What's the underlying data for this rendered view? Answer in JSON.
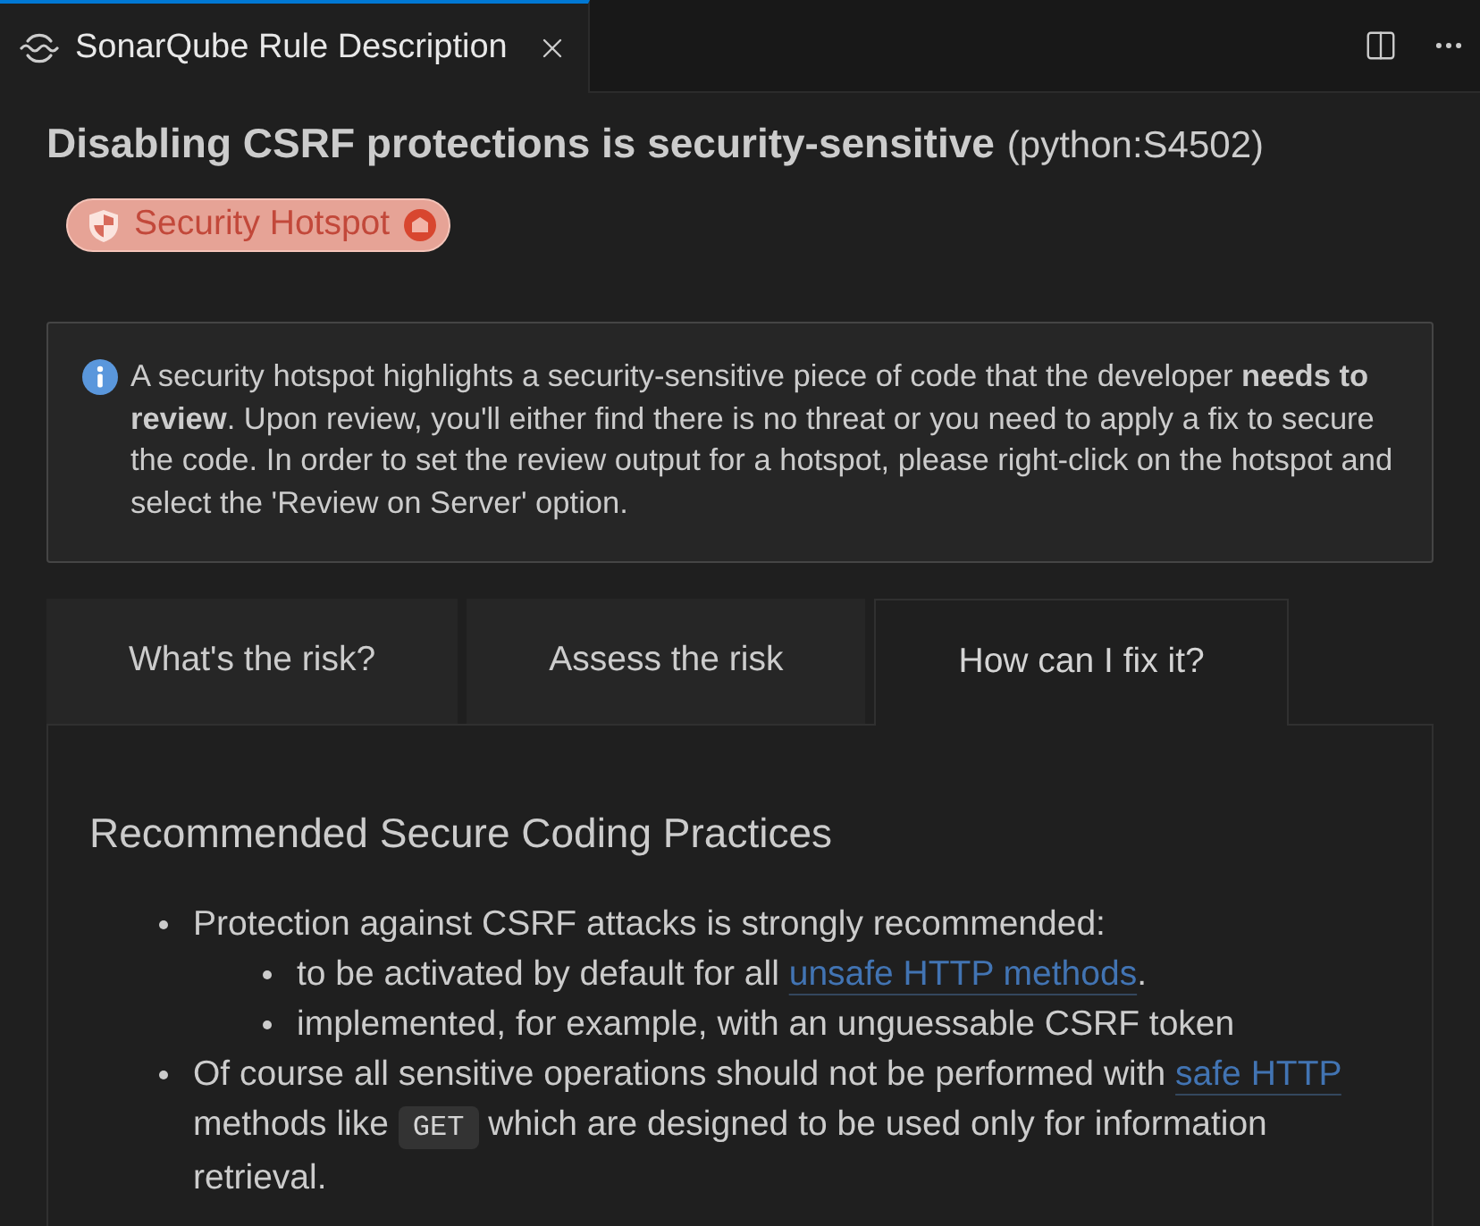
{
  "editor_tab": {
    "title": "SonarQube Rule Description",
    "selected": true
  },
  "rule": {
    "title": "Disabling CSRF protections is security-sensitive",
    "key": "(python:S4502)",
    "badge": {
      "label": "Security Hotspot"
    }
  },
  "notice": {
    "text": "A security hotspot highlights a security-sensitive piece of code that the developer **needs to review**. Upon review, you'll either find there is no threat or you need to apply a fix to secure the code. In order to set the review output for a hotspot, please right-click on the hotspot and select the 'Review on Server' option."
  },
  "section_tabs": [
    {
      "label": "What's the risk?",
      "selected": false
    },
    {
      "label": "Assess the risk",
      "selected": false
    },
    {
      "label": "How can I fix it?",
      "selected": true
    }
  ],
  "section": {
    "heading": "Recommended Secure Coding Practices",
    "items": [
      {
        "parts": [
          {
            "kind": "text",
            "text": "Protection against CSRF attacks is strongly recommended:"
          }
        ],
        "children": [
          {
            "parts": [
              {
                "kind": "text",
                "text": "to be activated by default for all "
              },
              {
                "kind": "link",
                "text": "unsafe HTTP methods"
              },
              {
                "kind": "text",
                "text": "."
              }
            ]
          },
          {
            "parts": [
              {
                "kind": "text",
                "text": "implemented, for example, with an unguessable CSRF token"
              }
            ]
          }
        ]
      },
      {
        "parts": [
          {
            "kind": "text",
            "text": "Of course all sensitive operations should not be performed with "
          },
          {
            "kind": "link",
            "text": "safe HTTP"
          },
          {
            "kind": "text",
            "text": " methods like "
          },
          {
            "kind": "code",
            "text": "GET"
          },
          {
            "kind": "text",
            "text": " which are designed to be used only for information retrieval."
          }
        ]
      }
    ]
  }
}
